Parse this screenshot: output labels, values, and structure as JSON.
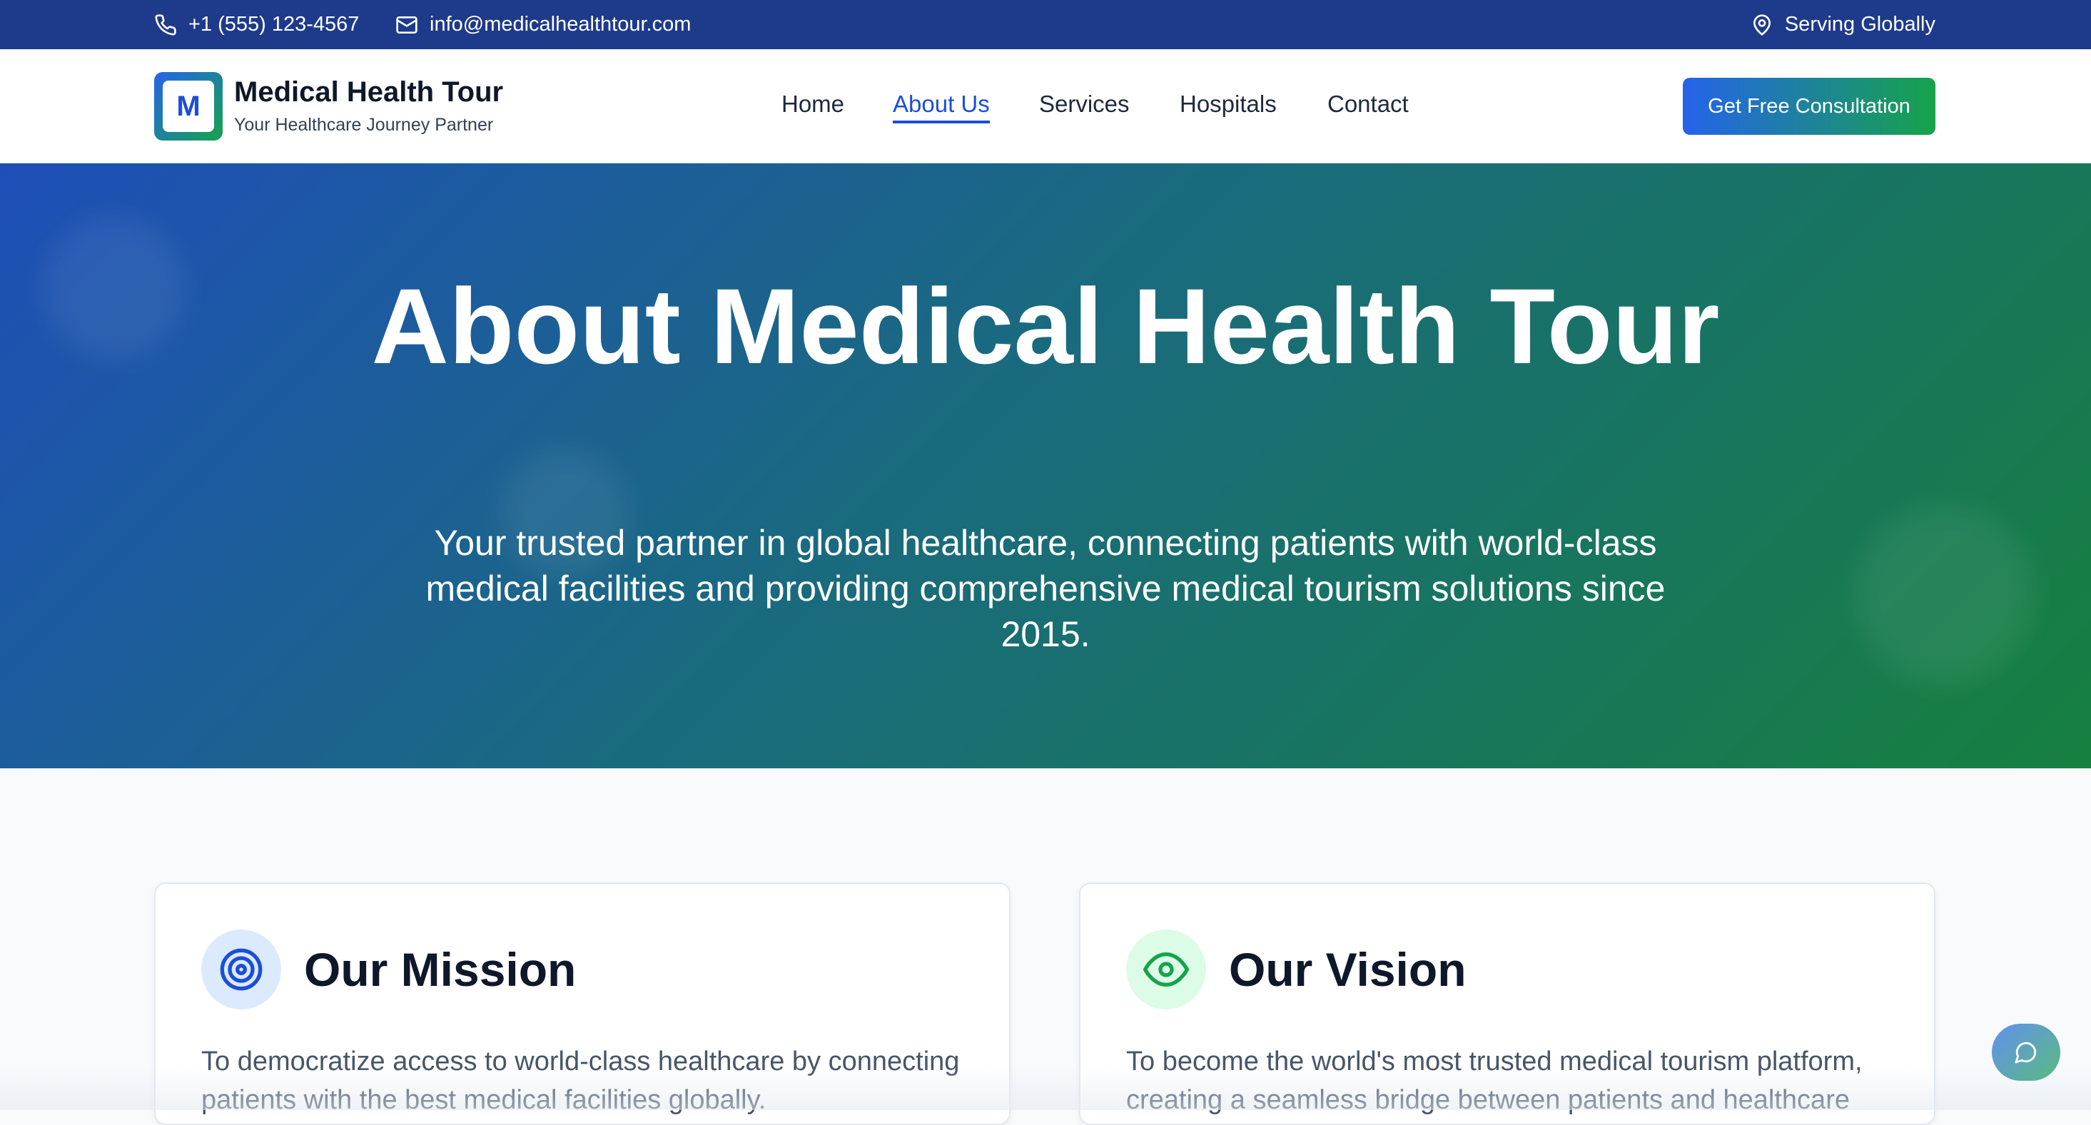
{
  "topbar": {
    "phone": "+1 (555) 123-4567",
    "email": "info@medicalhealthtour.com",
    "location": "Serving Globally"
  },
  "header": {
    "logo_letter": "M",
    "brand_name": "Medical Health Tour",
    "tagline": "Your Healthcare Journey Partner",
    "nav": [
      {
        "label": "Home"
      },
      {
        "label": "About Us",
        "active": true
      },
      {
        "label": "Services"
      },
      {
        "label": "Hospitals"
      },
      {
        "label": "Contact"
      }
    ],
    "cta_label": "Get Free Consultation"
  },
  "hero": {
    "title": "About Medical Health Tour",
    "subtitle": "Your trusted partner in global healthcare, connecting patients with world-class medical facilities and providing comprehensive medical tourism solutions since 2015."
  },
  "cards": [
    {
      "icon": "target-icon",
      "title": "Our Mission",
      "text": "To democratize access to world-class healthcare by connecting patients with the best medical facilities globally."
    },
    {
      "icon": "eye-icon",
      "title": "Our Vision",
      "text": "To become the world's most trusted medical tourism platform, creating a seamless bridge between patients and healthcare"
    }
  ],
  "colors": {
    "topbar_bg": "#1e3a8a",
    "accent_blue": "#1d4ed8",
    "accent_green": "#16a34a",
    "page_bg": "#f8fafc"
  },
  "icons": {
    "phone": "phone-icon",
    "email": "mail-icon",
    "location": "map-pin-icon",
    "chat": "chat-icon"
  }
}
